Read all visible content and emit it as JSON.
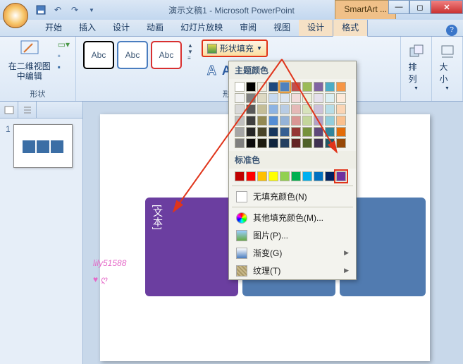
{
  "title": "演示文稿1 - Microsoft PowerPoint",
  "context_tab": "SmartArt ...",
  "tabs": [
    "开始",
    "插入",
    "设计",
    "动画",
    "幻灯片放映",
    "审阅",
    "视图",
    "设计",
    "格式"
  ],
  "active_tab": 8,
  "ribbon": {
    "edit2d": "在二维视图中编辑",
    "group_shapes": "形状",
    "group_styles": "形状样式",
    "abc": "Abc",
    "fill_label": "形状填充",
    "arrange": "排列",
    "size": "大小"
  },
  "dropdown": {
    "theme_h": "主题颜色",
    "std_h": "标准色",
    "no_fill": "无填充颜色(N)",
    "more_fill": "其他填充颜色(M)...",
    "picture": "图片(P)...",
    "gradient": "渐变(G)",
    "texture": "纹理(T)",
    "theme_row": [
      "#ffffff",
      "#000000",
      "#eeece1",
      "#1f497d",
      "#4f81bd",
      "#c0504d",
      "#9bbb59",
      "#8064a2",
      "#4bacc6",
      "#f79646"
    ],
    "theme_tint1": [
      "#f2f2f2",
      "#7f7f7f",
      "#ddd9c3",
      "#c6d9f0",
      "#dbe5f1",
      "#f2dcdb",
      "#ebf1dd",
      "#e5e0ec",
      "#dbeef3",
      "#fdeada"
    ],
    "theme_tint2": [
      "#d8d8d8",
      "#595959",
      "#c4bd97",
      "#8db3e2",
      "#b8cce4",
      "#e5b9b7",
      "#d7e3bc",
      "#ccc1d9",
      "#b7dde8",
      "#fbd5b5"
    ],
    "theme_tint3": [
      "#bfbfbf",
      "#3f3f3f",
      "#938953",
      "#548dd4",
      "#95b3d7",
      "#d99694",
      "#c3d69b",
      "#b2a2c7",
      "#92cddc",
      "#fac08f"
    ],
    "theme_tint4": [
      "#a5a5a5",
      "#262626",
      "#494429",
      "#17365d",
      "#366092",
      "#953734",
      "#76923c",
      "#5f497a",
      "#31859b",
      "#e36c09"
    ],
    "theme_tint5": [
      "#7f7f7f",
      "#0c0c0c",
      "#1d1b10",
      "#0f243e",
      "#244061",
      "#632423",
      "#4f6128",
      "#3f3151",
      "#205867",
      "#974806"
    ],
    "std_row": [
      "#c00000",
      "#ff0000",
      "#ffc000",
      "#ffff00",
      "#92d050",
      "#00b050",
      "#00b0f0",
      "#0070c0",
      "#002060",
      "#7030a0"
    ],
    "highlight_theme_idx": 4,
    "highlight_std_idx": 9
  },
  "slide": {
    "thumb_num": "1",
    "text_label": "[文本]"
  },
  "watermark": "lily51588"
}
